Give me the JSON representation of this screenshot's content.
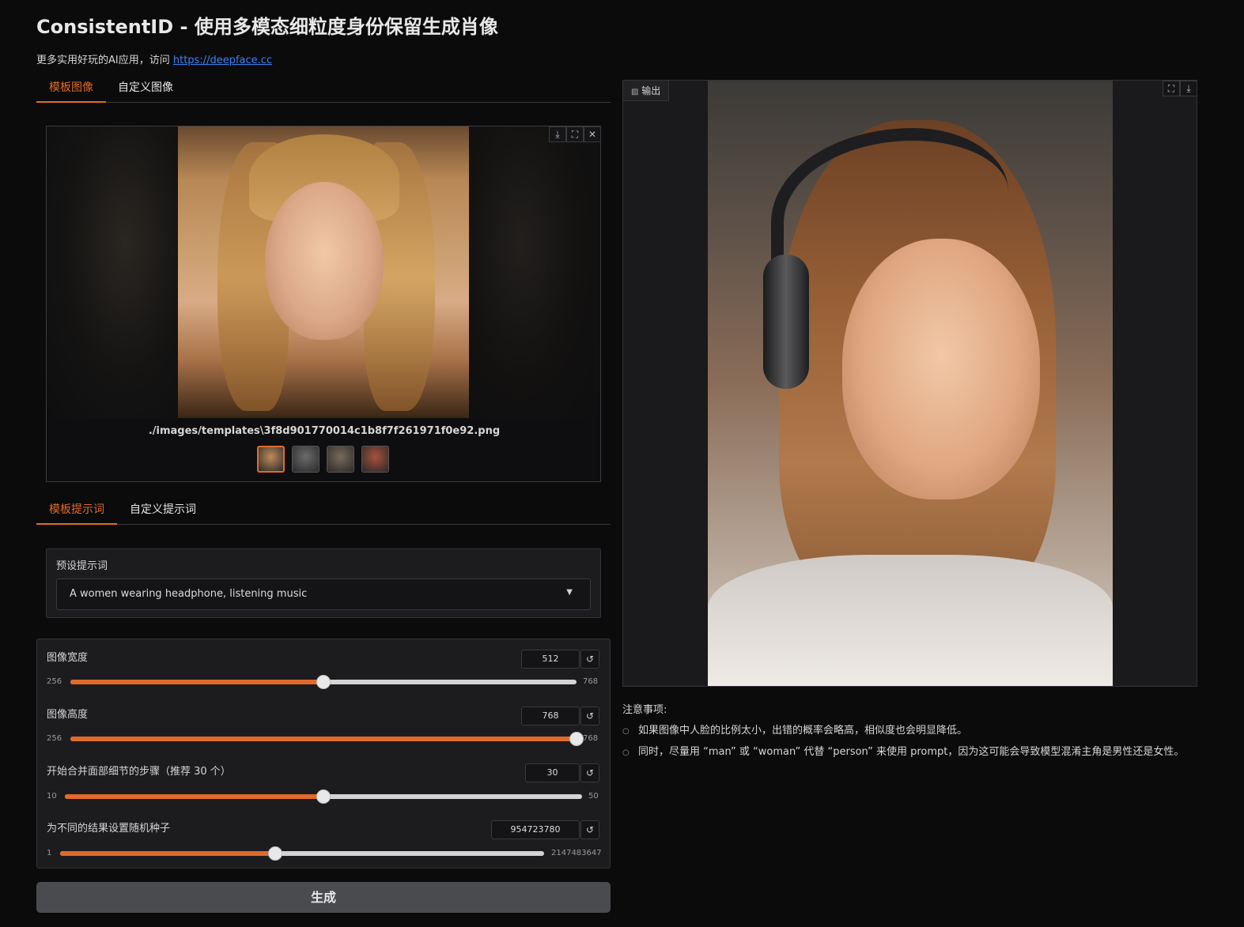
{
  "header": {
    "title": "ConsistentID - 使用多模态细粒度身份保留生成肖像",
    "subtitle_prefix": "更多实用好玩的AI应用，访问 ",
    "subtitle_link": "https://deepface.cc"
  },
  "image_tabs": [
    {
      "label": "模板图像",
      "active": true
    },
    {
      "label": "自定义图像",
      "active": false
    }
  ],
  "gallery": {
    "caption": "./images/templates\\3f8d901770014c1b8f7f261971f0e92.png",
    "icons": [
      "download-icon",
      "fullscreen-icon",
      "close-icon"
    ],
    "thumb_colors": [
      "#c08a5a",
      "#6b6b6b",
      "#7a6a5a",
      "#a8503c"
    ]
  },
  "prompt_tabs": [
    {
      "label": "模板提示词",
      "active": true
    },
    {
      "label": "自定义提示词",
      "active": false
    }
  ],
  "preset_prompt": {
    "label": "预设提示词",
    "value": "A women wearing headphone, listening music"
  },
  "sliders": [
    {
      "label": "图像宽度",
      "value": "512",
      "min": "256",
      "max": "768",
      "fraction": 0.5
    },
    {
      "label": "图像高度",
      "value": "768",
      "min": "256",
      "max": "768",
      "fraction": 1.0
    },
    {
      "label": "开始合并面部细节的步骤（推荐 30 个）",
      "value": "30",
      "min": "10",
      "max": "50",
      "fraction": 0.5
    },
    {
      "label": "为不同的结果设置随机种子",
      "value": "954723780",
      "min": "1",
      "max": "2147483647",
      "fraction": 0.4446
    }
  ],
  "generate_label": "生成",
  "output": {
    "label": "输出",
    "icons": [
      "fullscreen-icon",
      "download-icon"
    ]
  },
  "notes": {
    "title": "注意事项:",
    "items": [
      "如果图像中人脸的比例太小，出错的概率会略高，相似度也会明显降低。",
      "同时，尽量用 “man” 或 “woman” 代替 “person” 来使用 prompt，因为这可能会导致模型混淆主角是男性还是女性。"
    ]
  },
  "colors": {
    "accent": "#e06a2c",
    "background": "#0b0b0c",
    "panel": "#1c1c1f"
  }
}
